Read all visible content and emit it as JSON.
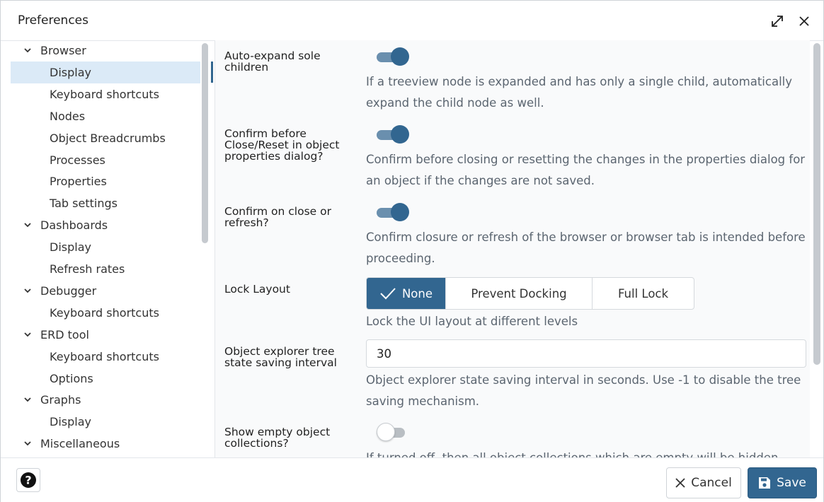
{
  "dialog": {
    "title": "Preferences",
    "maximize_icon": "expand-diagonal-icon",
    "close_icon": "close-icon"
  },
  "sidebar": {
    "items": [
      {
        "label": "Browser",
        "level": 0,
        "expanded": true
      },
      {
        "label": "Display",
        "level": 1,
        "selected": true
      },
      {
        "label": "Keyboard shortcuts",
        "level": 1
      },
      {
        "label": "Nodes",
        "level": 1
      },
      {
        "label": "Object Breadcrumbs",
        "level": 1
      },
      {
        "label": "Processes",
        "level": 1
      },
      {
        "label": "Properties",
        "level": 1
      },
      {
        "label": "Tab settings",
        "level": 1
      },
      {
        "label": "Dashboards",
        "level": 0,
        "expanded": true
      },
      {
        "label": "Display",
        "level": 1
      },
      {
        "label": "Refresh rates",
        "level": 1
      },
      {
        "label": "Debugger",
        "level": 0,
        "expanded": true
      },
      {
        "label": "Keyboard shortcuts",
        "level": 1
      },
      {
        "label": "ERD tool",
        "level": 0,
        "expanded": true
      },
      {
        "label": "Keyboard shortcuts",
        "level": 1
      },
      {
        "label": "Options",
        "level": 1
      },
      {
        "label": "Graphs",
        "level": 0,
        "expanded": true
      },
      {
        "label": "Display",
        "level": 1
      },
      {
        "label": "Miscellaneous",
        "level": 0,
        "expanded": true
      }
    ]
  },
  "settings": {
    "auto_expand": {
      "label": "Auto-expand sole children",
      "enabled": true,
      "help": "If a treeview node is expanded and has only a single child, automatically expand the child node as well."
    },
    "confirm_close_reset": {
      "label": "Confirm before Close/Reset in object properties dialog?",
      "enabled": true,
      "help": "Confirm before closing or resetting the changes in the properties dialog for an object if the changes are not saved."
    },
    "confirm_refresh": {
      "label": "Confirm on close or refresh?",
      "enabled": true,
      "help": "Confirm closure or refresh of the browser or browser tab is intended before proceeding."
    },
    "lock_layout": {
      "label": "Lock Layout",
      "options": [
        "None",
        "Prevent Docking",
        "Full Lock"
      ],
      "selected": "None",
      "help": "Lock the UI layout at different levels"
    },
    "tree_state_interval": {
      "label": "Object explorer tree state saving interval",
      "value": "30",
      "help": "Object explorer state saving interval in seconds. Use -1 to disable the tree saving mechanism."
    },
    "show_empty_collections": {
      "label": "Show empty object collections?",
      "enabled": false,
      "help": "If turned off, then all object collections which are empty will be hidden."
    }
  },
  "footer": {
    "help_icon": "question-circle-icon",
    "cancel_label": "Cancel",
    "cancel_icon": "close-icon",
    "save_label": "Save",
    "save_icon": "floppy-disk-icon"
  },
  "colors": {
    "accent": "#326690",
    "selected_bg": "#dbeaf7"
  }
}
